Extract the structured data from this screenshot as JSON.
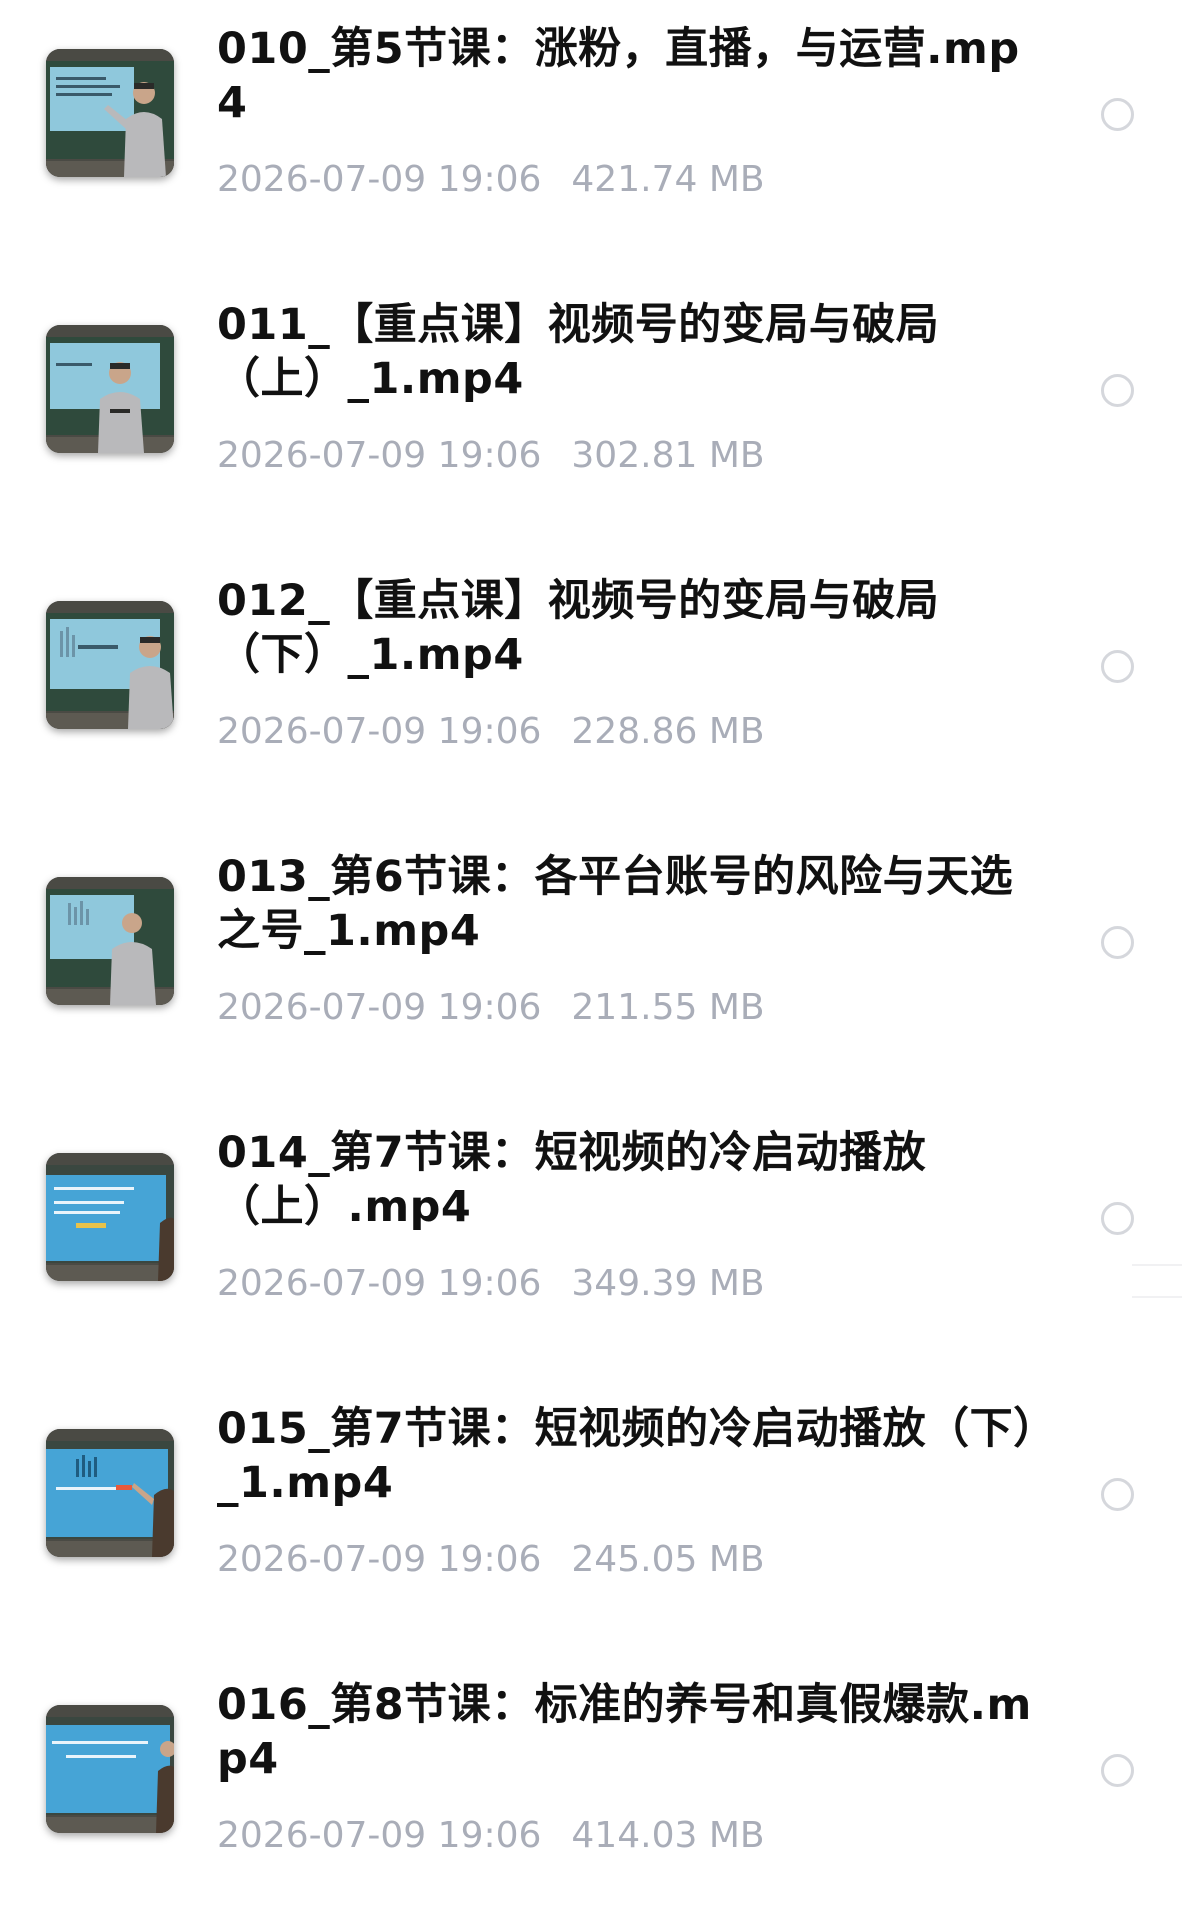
{
  "files": [
    {
      "title": "010_第5节课：涨粉，直播，与运营.mp4",
      "date": "2026-07-09 19:06",
      "size": "421.74 MB",
      "thumbnail": "video-thumbnail-blackboard-lecturer",
      "selected": false
    },
    {
      "title": "011_【重点课】视频号的变局与破局（上）_1.mp4",
      "date": "2026-07-09 19:06",
      "size": "302.81 MB",
      "thumbnail": "video-thumbnail-blackboard-lecturer",
      "selected": false
    },
    {
      "title": "012_【重点课】视频号的变局与破局（下）_1.mp4",
      "date": "2026-07-09 19:06",
      "size": "228.86 MB",
      "thumbnail": "video-thumbnail-blackboard-lecturer",
      "selected": false
    },
    {
      "title": "013_第6节课：各平台账号的风险与天选之号_1.mp4",
      "date": "2026-07-09 19:06",
      "size": "211.55 MB",
      "thumbnail": "video-thumbnail-blackboard-lecturer",
      "selected": false
    },
    {
      "title": "014_第7节课：短视频的冷启动播放（上）.mp4",
      "date": "2026-07-09 19:06",
      "size": "349.39 MB",
      "thumbnail": "video-thumbnail-projector-slide",
      "selected": false
    },
    {
      "title": "015_第7节课：短视频的冷启动播放（下）_1.mp4",
      "date": "2026-07-09 19:06",
      "size": "245.05 MB",
      "thumbnail": "video-thumbnail-projector-slide",
      "selected": false
    },
    {
      "title": "016_第8节课：标准的养号和真假爆款.mp4",
      "date": "2026-07-09 19:06",
      "size": "414.03 MB",
      "thumbnail": "video-thumbnail-projector-slide",
      "selected": false
    }
  ],
  "colors": {
    "title": "#111111",
    "meta": "#a9adb8",
    "radio_border": "#d5d7dc",
    "background": "#ffffff"
  }
}
